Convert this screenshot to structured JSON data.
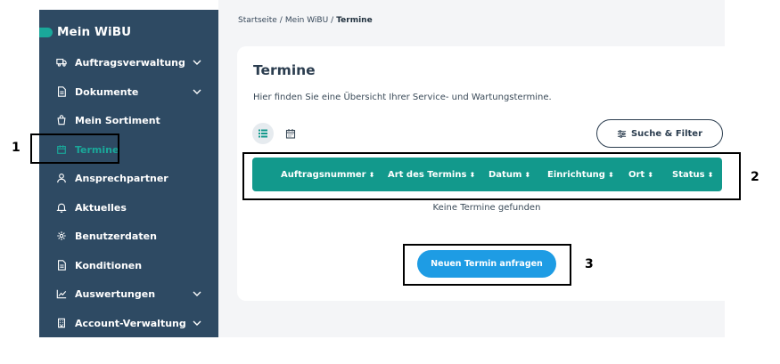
{
  "sidebar": {
    "brand": "Mein WiBU",
    "items": [
      {
        "label": "Auftragsverwaltung",
        "icon": "truck-icon",
        "has_chevron": true,
        "active": false
      },
      {
        "label": "Dokumente",
        "icon": "document-icon",
        "has_chevron": true,
        "active": false
      },
      {
        "label": "Mein Sortiment",
        "icon": "shopping-bag-icon",
        "has_chevron": false,
        "active": false
      },
      {
        "label": "Termine",
        "icon": "calendar-icon",
        "has_chevron": false,
        "active": true
      },
      {
        "label": "Ansprechpartner",
        "icon": "person-icon",
        "has_chevron": false,
        "active": false
      },
      {
        "label": "Aktuelles",
        "icon": "bell-icon",
        "has_chevron": false,
        "active": false
      },
      {
        "label": "Benutzerdaten",
        "icon": "settings-icon",
        "has_chevron": false,
        "active": false
      },
      {
        "label": "Konditionen",
        "icon": "document-icon",
        "has_chevron": false,
        "active": false
      },
      {
        "label": "Auswertungen",
        "icon": "chart-icon",
        "has_chevron": true,
        "active": false
      },
      {
        "label": "Account-Verwaltung",
        "icon": "building-icon",
        "has_chevron": true,
        "active": false
      }
    ]
  },
  "breadcrumb": {
    "items": [
      "Startseite",
      "Mein WiBU"
    ],
    "separator": "/",
    "current": "Termine"
  },
  "page": {
    "title": "Termine",
    "description": "Hier finden Sie eine Übersicht Ihrer Service- und Wartungstermine.",
    "filter_button": "Suche & Filter",
    "empty_message": "Keine Termine gefunden",
    "primary_button": "Neuen Termin anfragen"
  },
  "table": {
    "columns": [
      "Auftragsnummer",
      "Art des Termins",
      "Datum",
      "Einrichtung",
      "Ort",
      "Status"
    ],
    "sort_glyph": "⬍"
  },
  "annotations": {
    "labels": [
      "1",
      "2",
      "3"
    ]
  },
  "colors": {
    "sidebar_bg": "#2e4a63",
    "accent_teal": "#12998c",
    "primary_blue": "#1e9ce4",
    "text_dark": "#2b3d4f"
  }
}
